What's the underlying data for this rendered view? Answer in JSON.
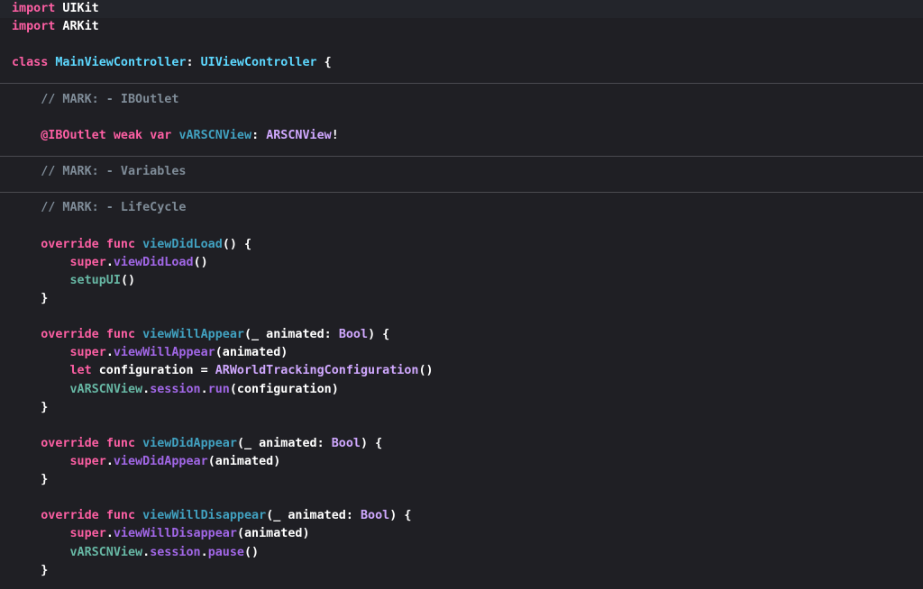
{
  "theme": {
    "background": "#1f1f24",
    "current_line": "#23252b",
    "divider": "#4a4a50",
    "colors": {
      "kw": "#fc5fa3",
      "plain": "#ffffff",
      "typedecl": "#5dd8ff",
      "typeref": "#d0a8ff",
      "ident": "#41a1c0",
      "method": "#67b7a4",
      "comment": "#7f8c98",
      "attr": "#fd8f3f",
      "self": "#a167e6"
    }
  },
  "code_lines": [
    {
      "tokens": [
        {
          "t": "import",
          "c": "kw"
        },
        {
          "t": " UIKit",
          "c": "plain"
        }
      ]
    },
    {
      "tokens": [
        {
          "t": "import",
          "c": "kw"
        },
        {
          "t": " ARKit",
          "c": "plain"
        }
      ]
    },
    {
      "tokens": []
    },
    {
      "tokens": [
        {
          "t": "class",
          "c": "kw"
        },
        {
          "t": " ",
          "c": "plain"
        },
        {
          "t": "MainViewController",
          "c": "typedecl"
        },
        {
          "t": ": ",
          "c": "plain"
        },
        {
          "t": "UIViewController",
          "c": "typedecl"
        },
        {
          "t": " {",
          "c": "plain"
        }
      ]
    },
    {
      "tokens": []
    },
    {
      "tokens": [
        {
          "t": "    // MARK: - IBOutlet",
          "c": "comment"
        }
      ]
    },
    {
      "tokens": []
    },
    {
      "tokens": [
        {
          "t": "    ",
          "c": "plain"
        },
        {
          "t": "@IBOutlet",
          "c": "kw"
        },
        {
          "t": " ",
          "c": "plain"
        },
        {
          "t": "weak",
          "c": "kw"
        },
        {
          "t": " ",
          "c": "plain"
        },
        {
          "t": "var",
          "c": "kw"
        },
        {
          "t": " ",
          "c": "plain"
        },
        {
          "t": "vARSCNView",
          "c": "ident"
        },
        {
          "t": ": ",
          "c": "plain"
        },
        {
          "t": "ARSCNView",
          "c": "typeref"
        },
        {
          "t": "!",
          "c": "plain"
        }
      ]
    },
    {
      "tokens": []
    },
    {
      "tokens": [
        {
          "t": "    // MARK: - Variables",
          "c": "comment"
        }
      ]
    },
    {
      "tokens": []
    },
    {
      "tokens": [
        {
          "t": "    // MARK: - LifeCycle",
          "c": "comment"
        }
      ]
    },
    {
      "tokens": []
    },
    {
      "tokens": [
        {
          "t": "    ",
          "c": "plain"
        },
        {
          "t": "override",
          "c": "kw"
        },
        {
          "t": " ",
          "c": "plain"
        },
        {
          "t": "func",
          "c": "kw"
        },
        {
          "t": " ",
          "c": "plain"
        },
        {
          "t": "viewDidLoad",
          "c": "ident"
        },
        {
          "t": "() {",
          "c": "plain"
        }
      ]
    },
    {
      "tokens": [
        {
          "t": "        ",
          "c": "plain"
        },
        {
          "t": "super",
          "c": "kw"
        },
        {
          "t": ".",
          "c": "plain"
        },
        {
          "t": "viewDidLoad",
          "c": "self"
        },
        {
          "t": "()",
          "c": "plain"
        }
      ]
    },
    {
      "tokens": [
        {
          "t": "        ",
          "c": "plain"
        },
        {
          "t": "setupUI",
          "c": "method"
        },
        {
          "t": "()",
          "c": "plain"
        }
      ]
    },
    {
      "tokens": [
        {
          "t": "    }",
          "c": "plain"
        }
      ]
    },
    {
      "tokens": []
    },
    {
      "tokens": [
        {
          "t": "    ",
          "c": "plain"
        },
        {
          "t": "override",
          "c": "kw"
        },
        {
          "t": " ",
          "c": "plain"
        },
        {
          "t": "func",
          "c": "kw"
        },
        {
          "t": " ",
          "c": "plain"
        },
        {
          "t": "viewWillAppear",
          "c": "ident"
        },
        {
          "t": "(_ animated: ",
          "c": "plain"
        },
        {
          "t": "Bool",
          "c": "typeref"
        },
        {
          "t": ") {",
          "c": "plain"
        }
      ]
    },
    {
      "tokens": [
        {
          "t": "        ",
          "c": "plain"
        },
        {
          "t": "super",
          "c": "kw"
        },
        {
          "t": ".",
          "c": "plain"
        },
        {
          "t": "viewWillAppear",
          "c": "self"
        },
        {
          "t": "(animated)",
          "c": "plain"
        }
      ]
    },
    {
      "tokens": [
        {
          "t": "        ",
          "c": "plain"
        },
        {
          "t": "let",
          "c": "kw"
        },
        {
          "t": " configuration = ",
          "c": "plain"
        },
        {
          "t": "ARWorldTrackingConfiguration",
          "c": "typeref"
        },
        {
          "t": "()",
          "c": "plain"
        }
      ]
    },
    {
      "tokens": [
        {
          "t": "        ",
          "c": "plain"
        },
        {
          "t": "vARSCNView",
          "c": "method"
        },
        {
          "t": ".",
          "c": "plain"
        },
        {
          "t": "session",
          "c": "self"
        },
        {
          "t": ".",
          "c": "plain"
        },
        {
          "t": "run",
          "c": "self"
        },
        {
          "t": "(configuration)",
          "c": "plain"
        }
      ]
    },
    {
      "tokens": [
        {
          "t": "    }",
          "c": "plain"
        }
      ]
    },
    {
      "tokens": []
    },
    {
      "tokens": [
        {
          "t": "    ",
          "c": "plain"
        },
        {
          "t": "override",
          "c": "kw"
        },
        {
          "t": " ",
          "c": "plain"
        },
        {
          "t": "func",
          "c": "kw"
        },
        {
          "t": " ",
          "c": "plain"
        },
        {
          "t": "viewDidAppear",
          "c": "ident"
        },
        {
          "t": "(_ animated: ",
          "c": "plain"
        },
        {
          "t": "Bool",
          "c": "typeref"
        },
        {
          "t": ") {",
          "c": "plain"
        }
      ]
    },
    {
      "tokens": [
        {
          "t": "        ",
          "c": "plain"
        },
        {
          "t": "super",
          "c": "kw"
        },
        {
          "t": ".",
          "c": "plain"
        },
        {
          "t": "viewDidAppear",
          "c": "self"
        },
        {
          "t": "(animated)",
          "c": "plain"
        }
      ]
    },
    {
      "tokens": [
        {
          "t": "    }",
          "c": "plain"
        }
      ]
    },
    {
      "tokens": []
    },
    {
      "tokens": [
        {
          "t": "    ",
          "c": "plain"
        },
        {
          "t": "override",
          "c": "kw"
        },
        {
          "t": " ",
          "c": "plain"
        },
        {
          "t": "func",
          "c": "kw"
        },
        {
          "t": " ",
          "c": "plain"
        },
        {
          "t": "viewWillDisappear",
          "c": "ident"
        },
        {
          "t": "(_ animated: ",
          "c": "plain"
        },
        {
          "t": "Bool",
          "c": "typeref"
        },
        {
          "t": ") {",
          "c": "plain"
        }
      ]
    },
    {
      "tokens": [
        {
          "t": "        ",
          "c": "plain"
        },
        {
          "t": "super",
          "c": "kw"
        },
        {
          "t": ".",
          "c": "plain"
        },
        {
          "t": "viewWillDisappear",
          "c": "self"
        },
        {
          "t": "(animated)",
          "c": "plain"
        }
      ]
    },
    {
      "tokens": [
        {
          "t": "        ",
          "c": "plain"
        },
        {
          "t": "vARSCNView",
          "c": "method"
        },
        {
          "t": ".",
          "c": "plain"
        },
        {
          "t": "session",
          "c": "self"
        },
        {
          "t": ".",
          "c": "plain"
        },
        {
          "t": "pause",
          "c": "self"
        },
        {
          "t": "()",
          "c": "plain"
        }
      ]
    },
    {
      "tokens": [
        {
          "t": "    }",
          "c": "plain"
        }
      ]
    }
  ]
}
